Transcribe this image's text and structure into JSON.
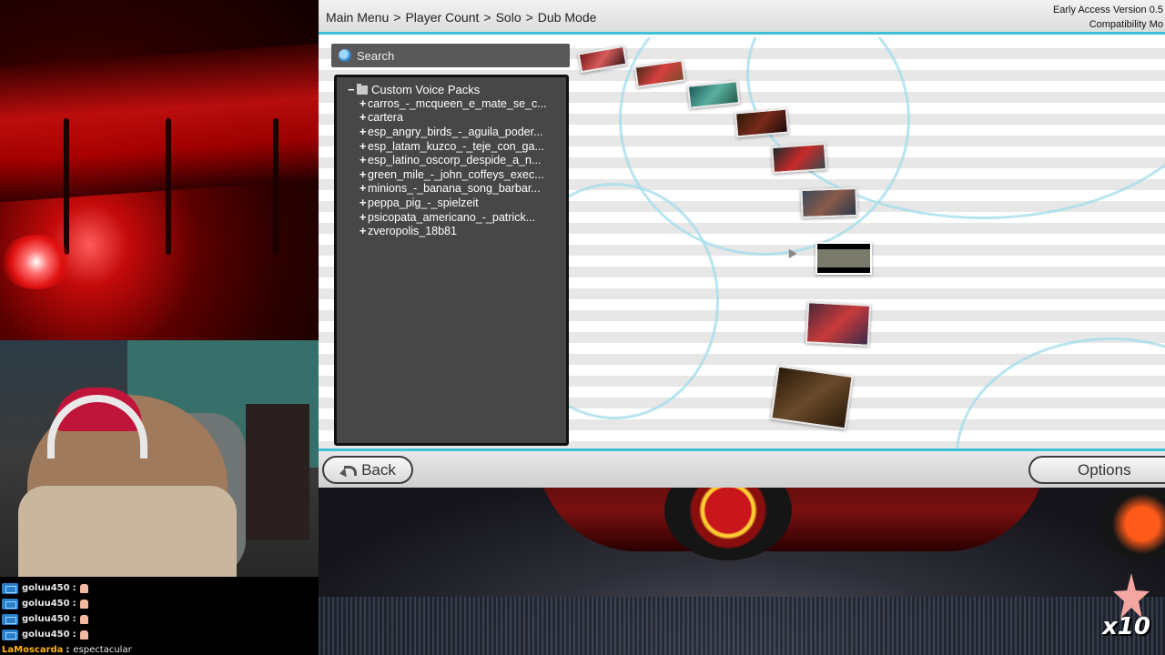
{
  "stream": {
    "chat": [
      {
        "user": "goluu450",
        "sep": ":",
        "message": ""
      },
      {
        "user": "goluu450",
        "sep": ":",
        "message": ""
      },
      {
        "user": "goluu450",
        "sep": ":",
        "message": ""
      },
      {
        "user": "goluu450",
        "sep": ":",
        "message": ""
      },
      {
        "user": "LaMoscarda",
        "sep": ":",
        "message": "espectacular"
      }
    ],
    "multiplier": "x10"
  },
  "header": {
    "breadcrumb": [
      "Main Menu",
      "Player Count",
      "Solo",
      "Dub Mode"
    ],
    "breadcrumb_separator": ">",
    "version_line1": "Early Access Version 0.5",
    "version_line2": "Compatibility Mo"
  },
  "search": {
    "placeholder": "Search",
    "value": ""
  },
  "tree": {
    "root_label": "Custom Voice Packs",
    "items": [
      {
        "label": "carros_-_mcqueen_e_mate_se_c..."
      },
      {
        "label": "cartera"
      },
      {
        "label": "esp_angry_birds_-_aguila_poder..."
      },
      {
        "label": "esp_latam_kuzco_-_teje_con_ga..."
      },
      {
        "label": "esp_latino_oscorp_despide_a_n..."
      },
      {
        "label": "green_mile_-_john_coffeys_exec..."
      },
      {
        "label": "minions_-_banana_song_barbar..."
      },
      {
        "label": "peppa_pig_-_spielzeit"
      },
      {
        "label": "psicopata_americano_-_patrick..."
      },
      {
        "label": "zveropolis_18b81"
      }
    ]
  },
  "footer": {
    "back_label": "Back",
    "options_label": "Options"
  },
  "colors": {
    "accent": "#3ec0d8",
    "panel": "#474747",
    "search_bg": "#595959"
  }
}
